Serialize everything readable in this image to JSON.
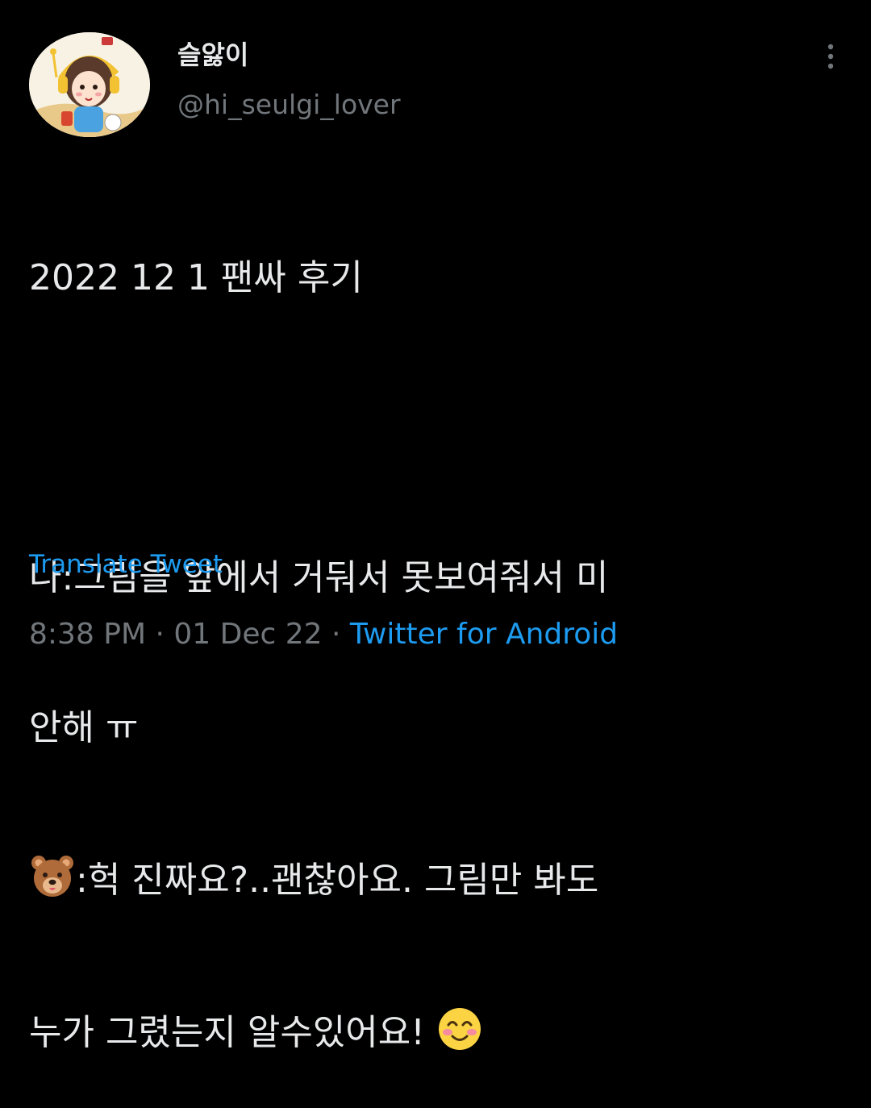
{
  "author": {
    "display_name": "슬앓이",
    "handle": "@hi_seulgi_lover"
  },
  "tweet": {
    "line1": "2022 12 1  팬싸 후기",
    "line2": "",
    "line3": "나:그림을 앞에서 거둬서 못보여줘서 미",
    "line4": "안해 ㅠ",
    "line5_text": ":헉 진짜요?..괜찮아요. 그림만 봐도",
    "line6_text": "누가 그렸는지 알수있어요! "
  },
  "emojis": {
    "bear": "bear-face",
    "smile": "smiling-face-with-smiling-eyes"
  },
  "translate_label": "Translate Tweet",
  "meta": {
    "time": "8:38 PM",
    "sep1": " · ",
    "date": "01 Dec 22",
    "sep2": " · ",
    "source": "Twitter for Android"
  },
  "colors": {
    "background": "#000000",
    "text": "#e7e9ea",
    "secondary": "#71767b",
    "link": "#1d9bf0"
  }
}
